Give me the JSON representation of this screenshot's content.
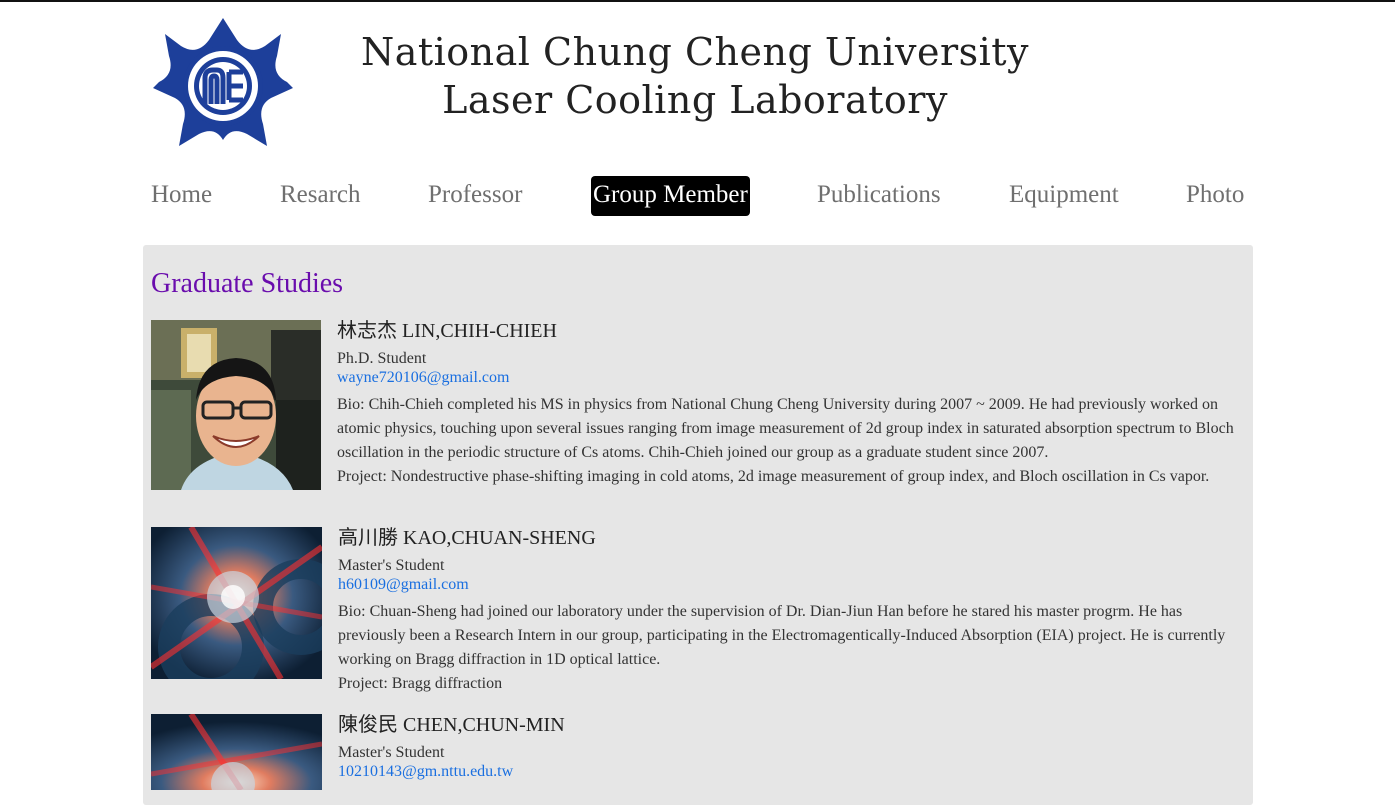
{
  "site": {
    "title_line1": "National Chung Cheng University",
    "title_line2": "Laser Cooling Laboratory",
    "logo_icon": "university-emblem-icon",
    "accent_color": "#1d3f9a"
  },
  "nav": {
    "items": [
      {
        "label": "Home"
      },
      {
        "label": "Resarch"
      },
      {
        "label": "Professor"
      },
      {
        "label": "Group Member",
        "active": true
      },
      {
        "label": "Publications"
      },
      {
        "label": "Equipment"
      },
      {
        "label": "Photo"
      }
    ]
  },
  "section": {
    "title": "Graduate Studies",
    "title_color": "#6a0dad"
  },
  "members": [
    {
      "name": "林志杰 LIN,CHIH-CHIEH",
      "role": "Ph.D. Student",
      "email": "wayne720106@gmail.com",
      "bio": "Bio: Chih-Chieh completed his MS in physics from National Chung Cheng University during 2007 ~ 2009. He had previously worked on atomic physics, touching upon several issues ranging from image measurement of 2d group index in saturated absorption spectrum to Bloch oscillation in the periodic structure of Cs atoms. Chih-Chieh joined our group as a graduate student since 2007.",
      "project": "Project: Nondestructive phase-shifting imaging in cold atoms, 2d image measurement of group index, and Bloch oscillation in Cs vapor.",
      "photo_type": "portrait"
    },
    {
      "name": "高川勝 KAO,CHUAN-SHENG",
      "role": "Master's Student",
      "email": "h60109@gmail.com",
      "bio": "Bio: Chuan-Sheng had joined our laboratory under the supervision of Dr. Dian-Jiun Han before he stared his master progrm. He has previously been a Research Intern in our group, participating in the Electromagentically-Induced Absorption (EIA) project. He is currently working on Bragg diffraction in 1D optical lattice.",
      "project": "Project: Bragg diffraction",
      "photo_type": "atom-trap"
    },
    {
      "name": "陳俊民 CHEN,CHUN-MIN",
      "role": "Master's Student",
      "email": "10210143@gm.nttu.edu.tw",
      "bio": "",
      "project": "",
      "photo_type": "atom-trap"
    }
  ]
}
